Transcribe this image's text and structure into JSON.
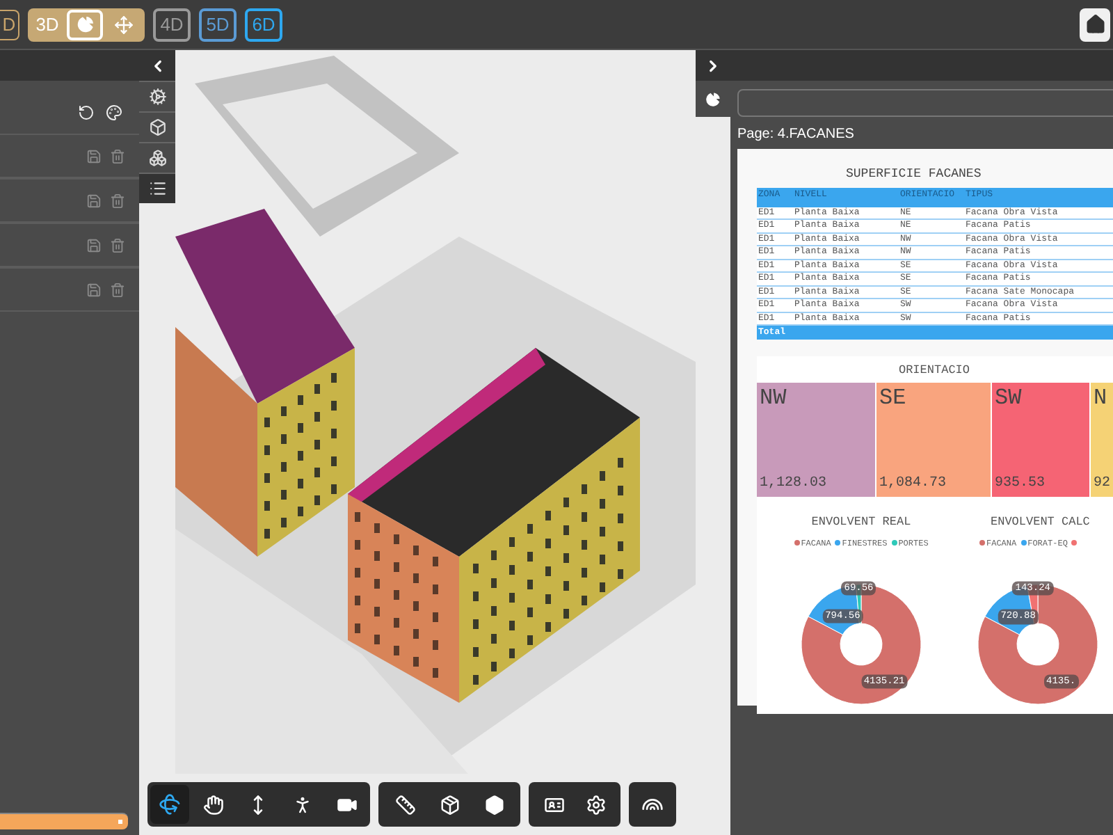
{
  "top_bar": {
    "cut_button": {
      "label": "D"
    },
    "dimension_3d": {
      "label": "3D",
      "chart_tool_selected": true,
      "move_tool_selected": false
    },
    "dimension_buttons": [
      {
        "label": "4D",
        "color": "#9a9a9a"
      },
      {
        "label": "5D",
        "color": "#5b9bd5"
      },
      {
        "label": "6D",
        "color": "#2ea8f0"
      }
    ]
  },
  "bottom_toolbar": {
    "orbit_selected": true
  },
  "report": {
    "page": "Page: 4.FACANES",
    "table": {
      "title": "SUPERFICIE FACANES",
      "columns": [
        "ZONA",
        "NIVELL",
        "ORIENTACIO",
        "TIPUS"
      ],
      "rows": [
        [
          "ED1",
          "Planta Baixa",
          "NE",
          "Facana Obra Vista"
        ],
        [
          "ED1",
          "Planta Baixa",
          "NE",
          "Facana Patis"
        ],
        [
          "ED1",
          "Planta Baixa",
          "NW",
          "Facana Obra Vista"
        ],
        [
          "ED1",
          "Planta Baixa",
          "NW",
          "Facana Patis"
        ],
        [
          "ED1",
          "Planta Baixa",
          "SE",
          "Facana Obra Vista"
        ],
        [
          "ED1",
          "Planta Baixa",
          "SE",
          "Facana Patis"
        ],
        [
          "ED1",
          "Planta Baixa",
          "SE",
          "Facana Sate Monocapa"
        ],
        [
          "ED1",
          "Planta Baixa",
          "SW",
          "Facana Obra Vista"
        ],
        [
          "ED1",
          "Planta Baixa",
          "SW",
          "Facana Patis"
        ]
      ],
      "total": "Total"
    },
    "treemap": {
      "title": "ORIENTACIO",
      "tiles": [
        {
          "label": "NW",
          "value": "1,128.03",
          "color": "#c89aba"
        },
        {
          "label": "SE",
          "value": "1,084.73",
          "color": "#f9a47e"
        },
        {
          "label": "SW",
          "value": "935.53",
          "color": "#f56474"
        },
        {
          "label": "N",
          "value": "92",
          "color": "#f5d275"
        }
      ]
    },
    "donut_real": {
      "chart_data": {
        "type": "donut",
        "title": "ENVOLVENT REAL",
        "categories": [
          "FACANA",
          "FINESTRES",
          "PORTES"
        ],
        "values": [
          4135.21,
          794.56,
          69.56
        ],
        "colors": [
          "#d4706b",
          "#3aa6ee",
          "#2ec9b8"
        ],
        "data_labels": true
      }
    },
    "donut_calc": {
      "title": "ENVOLVENT CALC",
      "legend": [
        {
          "label": "FACANA",
          "color": "#d4706b"
        },
        {
          "label": "FORAT-EQ",
          "color": "#3aa6ee"
        },
        {
          "color": "#f07272"
        }
      ],
      "slices": [
        {
          "label": "4135.",
          "color": "#d4706b"
        },
        {
          "label": "720.88",
          "color": "#3aa6ee"
        },
        {
          "label": "143.24",
          "color": "#f07272"
        }
      ]
    }
  }
}
